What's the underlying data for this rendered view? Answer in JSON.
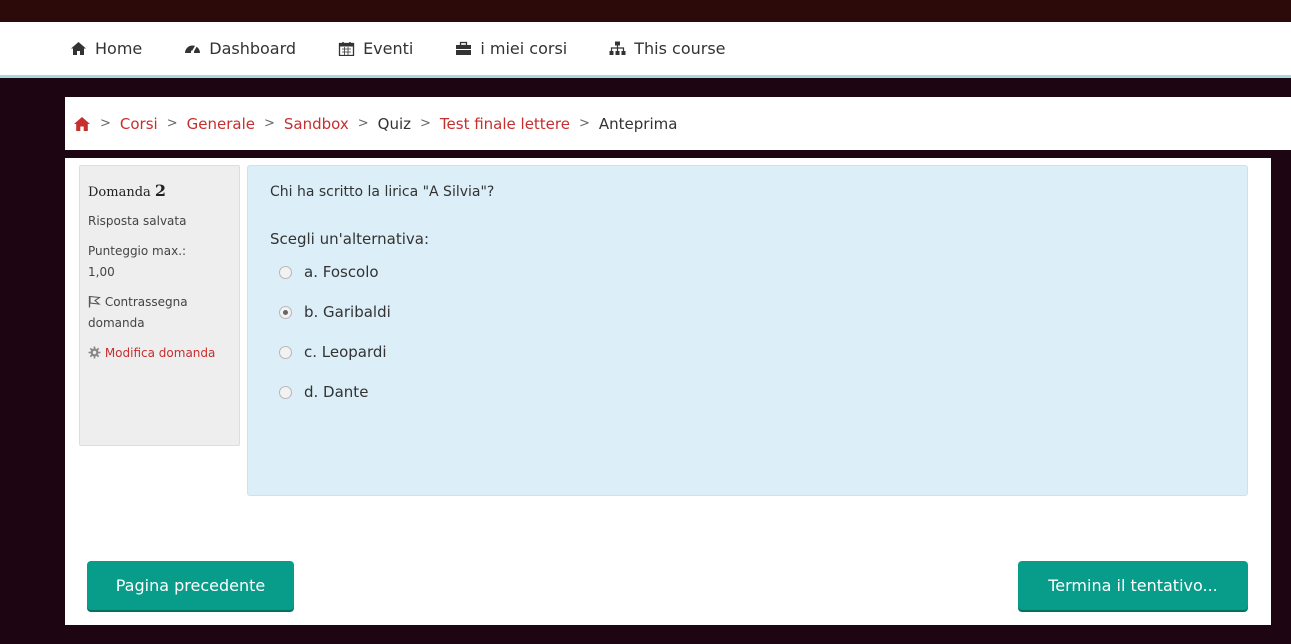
{
  "nav": {
    "items": [
      {
        "label": "Home",
        "icon": "home-icon"
      },
      {
        "label": "Dashboard",
        "icon": "dashboard-icon"
      },
      {
        "label": "Eventi",
        "icon": "calendar-icon"
      },
      {
        "label": "i miei corsi",
        "icon": "briefcase-icon"
      },
      {
        "label": "This course",
        "icon": "sitemap-icon"
      }
    ]
  },
  "breadcrumb": {
    "items": [
      "Corsi",
      "Generale",
      "Sandbox",
      "Quiz",
      "Test finale lettere",
      "Anteprima"
    ],
    "separator": ">"
  },
  "question_info": {
    "label": "Domanda",
    "number": "2",
    "state": "Risposta salvata",
    "grade_label": "Punteggio max.:",
    "grade_value": "1,00",
    "flag_label": "Contrassegna domanda",
    "edit_label": "Modifica domanda"
  },
  "question": {
    "text": "Chi ha scritto la lirica \"A Silvia\"?",
    "prompt": "Scegli un'alternativa:",
    "answers": [
      {
        "label": "a. Foscolo",
        "checked": false
      },
      {
        "label": "b. Garibaldi",
        "checked": true
      },
      {
        "label": "c. Leopardi",
        "checked": false
      },
      {
        "label": "d. Dante",
        "checked": false
      }
    ]
  },
  "buttons": {
    "previous": "Pagina precedente",
    "finish": "Termina il tentativo..."
  },
  "colors": {
    "accent": "#089c8a",
    "link": "#c72e2e",
    "question_bg": "#dceef7",
    "page_bg": "#1e0512"
  }
}
